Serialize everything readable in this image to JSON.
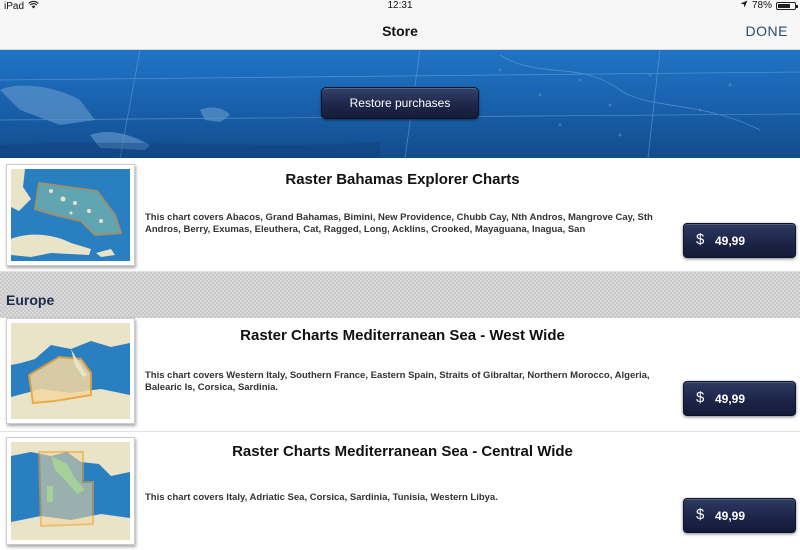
{
  "status_bar": {
    "device": "iPad",
    "time": "12:31",
    "battery": "78%",
    "battery_level": 0.78
  },
  "nav": {
    "title": "Store",
    "done_label": "DONE"
  },
  "banner": {
    "restore_label": "Restore purchases"
  },
  "products": [
    {
      "title": "Raster Bahamas Explorer Charts",
      "description": "This chart covers Abacos, Grand Bahamas, Bimini, New Providence, Chubb Cay, Nth Andros, Mangrove Cay, Sth Andros, Berry, Exumas, Eleuthera, Cat, Ragged, Long, Acklins, Crooked, Mayaguana, Inagua, San",
      "currency": "$",
      "price": "49,99"
    }
  ],
  "section": {
    "label": "Europe"
  },
  "europe_products": [
    {
      "title": "Raster Charts Mediterranean Sea - West Wide",
      "description": "This chart covers Western Italy, Southern France, Eastern Spain, Straits of Gibraltar, Northern Morocco, Algeria, Balearic Is, Corsica, Sardinia.",
      "currency": "$",
      "price": "49,99"
    },
    {
      "title": "Raster Charts Mediterranean Sea - Central Wide",
      "description": "This chart covers Italy, Adriatic Sea, Corsica, Sardinia, Tunisia, Western Libya.",
      "currency": "$",
      "price": "49,99"
    }
  ],
  "colors": {
    "accent": "#2b4a6e",
    "button_dark": "#1c2548",
    "sea": "#2a7fc1",
    "land": "#e9e4c8",
    "outline": "#f0a030"
  }
}
